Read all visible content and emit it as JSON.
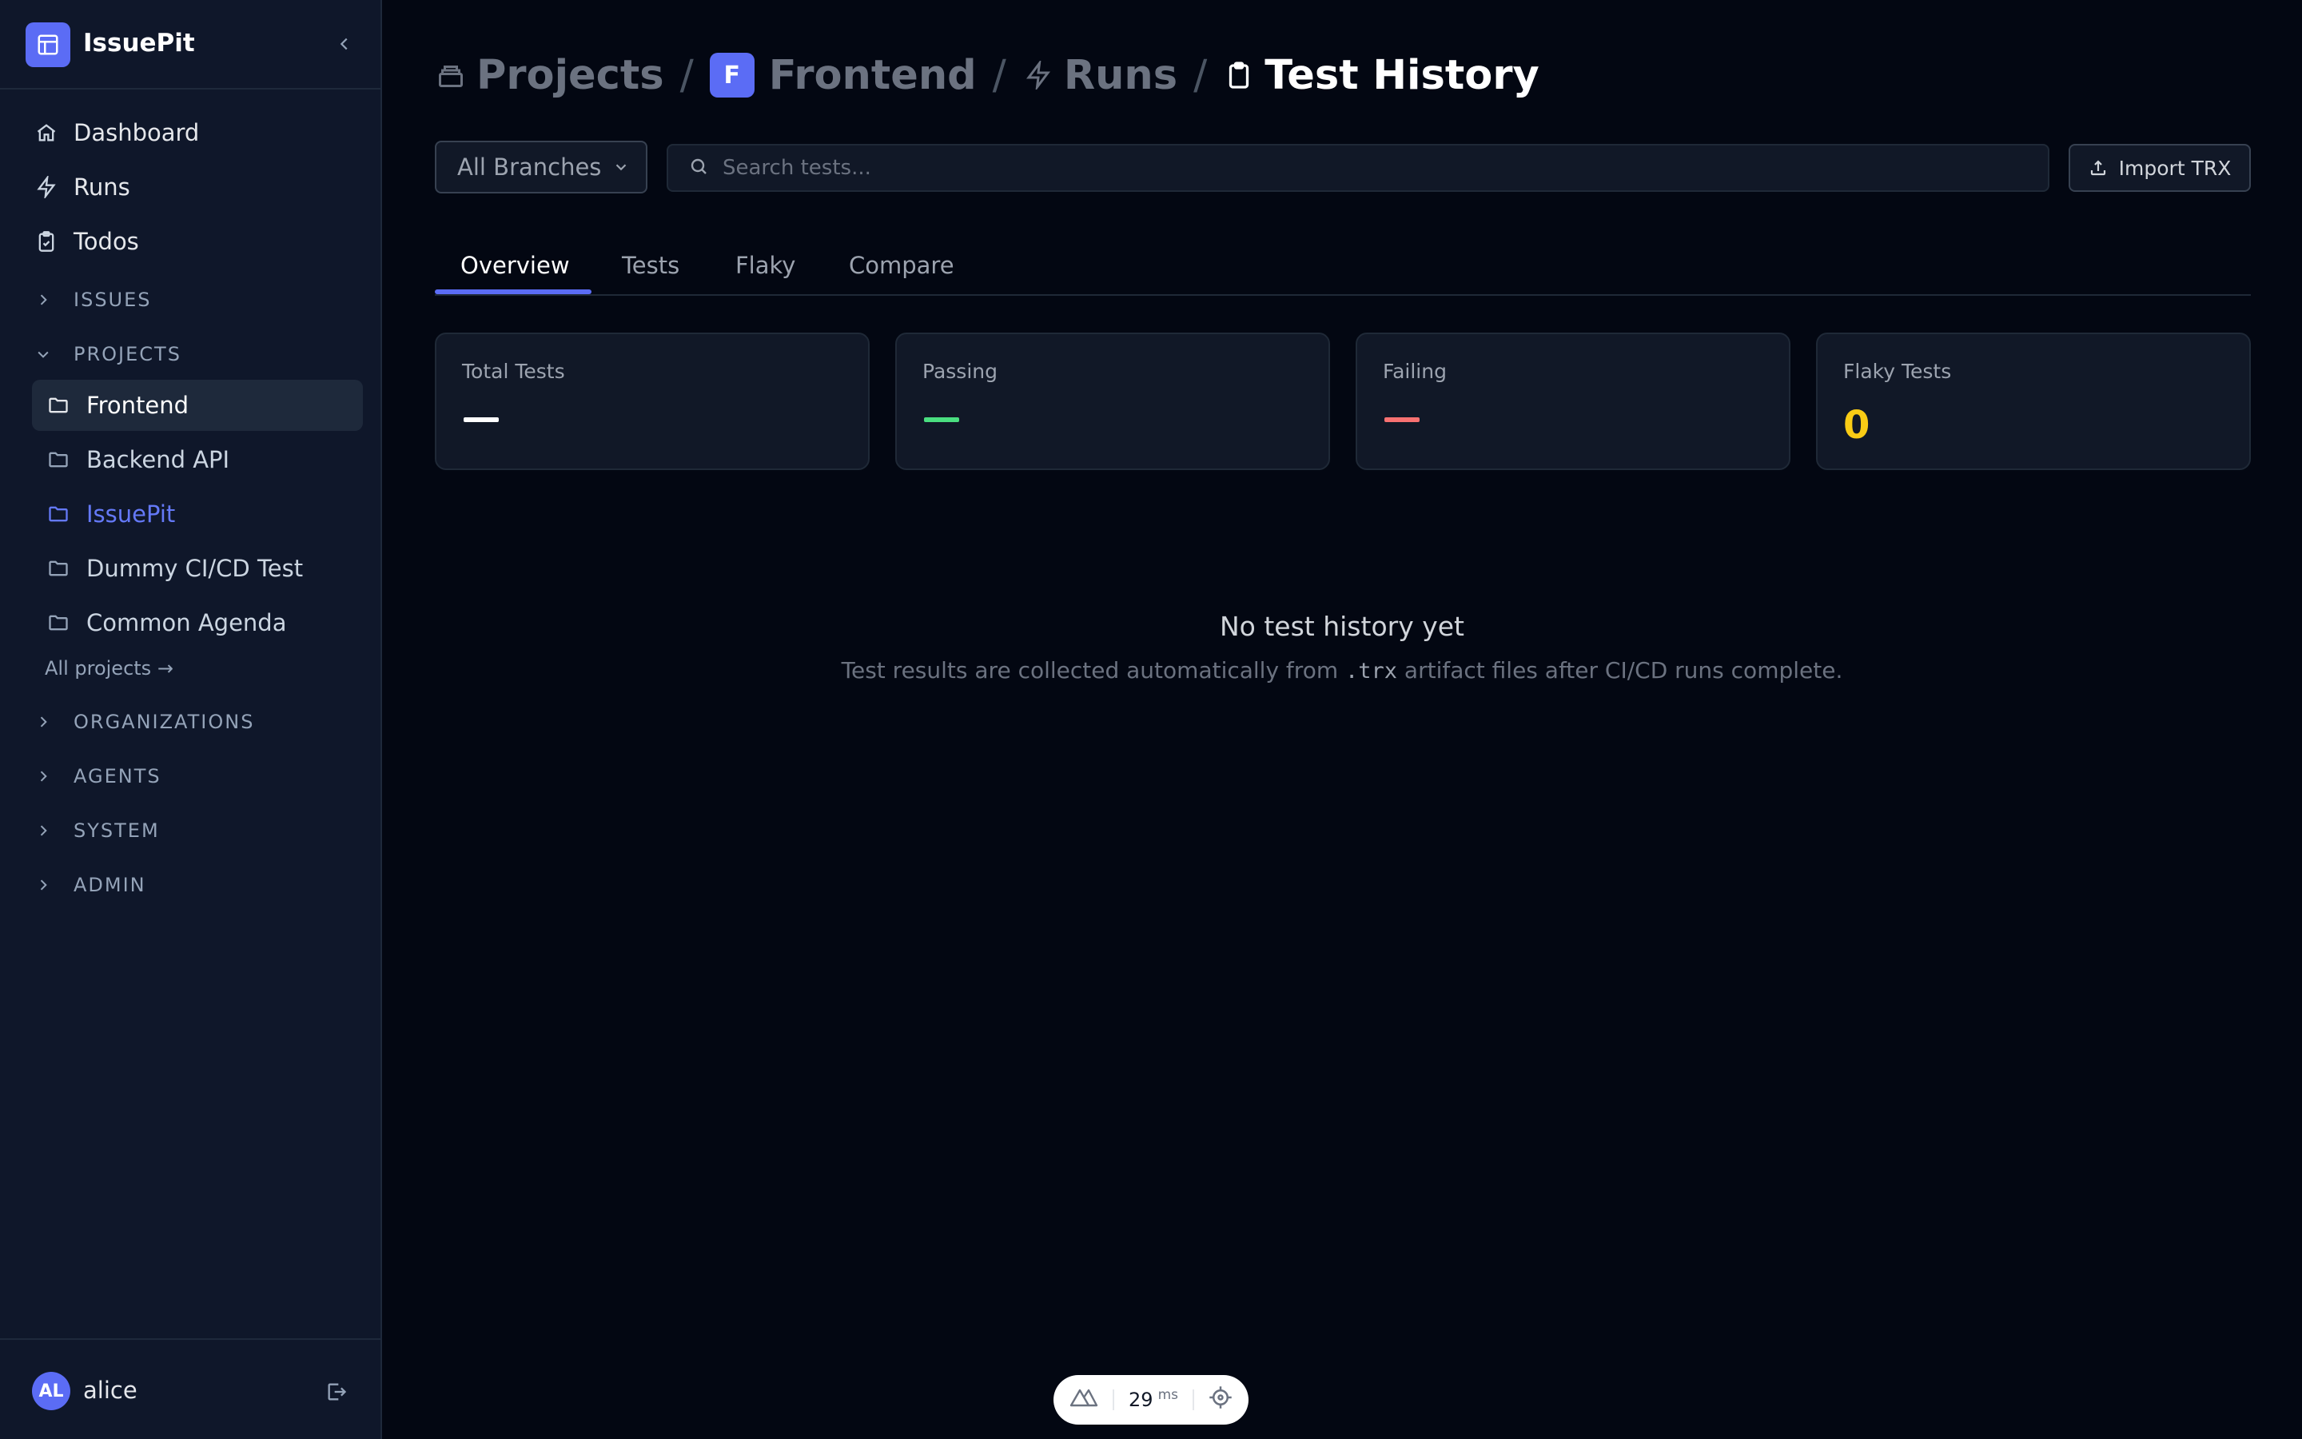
{
  "app": {
    "name": "IssuePit"
  },
  "sidebar": {
    "nav": [
      {
        "label": "Dashboard",
        "icon": "home-icon"
      },
      {
        "label": "Runs",
        "icon": "bolt-icon"
      },
      {
        "label": "Todos",
        "icon": "clipboard-check-icon"
      }
    ],
    "sections": {
      "issues": "ISSUES",
      "projects": "PROJECTS",
      "organizations": "ORGANIZATIONS",
      "agents": "AGENTS",
      "system": "SYSTEM",
      "admin": "ADMIN"
    },
    "projects": [
      {
        "label": "Frontend",
        "state": "active"
      },
      {
        "label": "Backend API",
        "state": "normal"
      },
      {
        "label": "IssuePit",
        "state": "highlight"
      },
      {
        "label": "Dummy CI/CD Test",
        "state": "normal"
      },
      {
        "label": "Common Agenda",
        "state": "normal"
      }
    ],
    "all_projects_label": "All projects →",
    "user": {
      "initials": "AL",
      "name": "alice"
    }
  },
  "breadcrumb": {
    "projects": "Projects",
    "project_initial": "F",
    "project": "Frontend",
    "runs": "Runs",
    "current": "Test History",
    "separator": "/"
  },
  "toolbar": {
    "branch_label": "All Branches",
    "search_placeholder": "Search tests...",
    "import_label": "Import TRX"
  },
  "tabs": [
    "Overview",
    "Tests",
    "Flaky",
    "Compare"
  ],
  "active_tab": "Overview",
  "stats": {
    "total_label": "Total Tests",
    "passing_label": "Passing",
    "failing_label": "Failing",
    "flaky_label": "Flaky Tests",
    "flaky_value": "0"
  },
  "empty_state": {
    "title": "No test history yet",
    "desc_before": "Test results are collected automatically from ",
    "desc_code": ".trx",
    "desc_after": " artifact files after CI/CD runs complete."
  },
  "devbar": {
    "value": "29",
    "unit": "ms"
  },
  "colors": {
    "accent": "#5b6cf5",
    "passing": "#4ade80",
    "failing": "#f87171",
    "flaky": "#facc15",
    "background": "#030712",
    "sidebar": "#0f172a"
  }
}
